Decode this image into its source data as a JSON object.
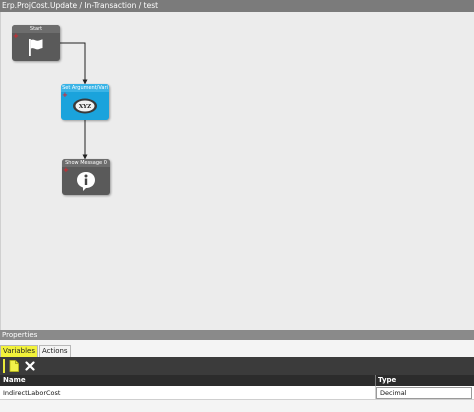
{
  "breadcrumb": "Erp.ProjCost.Update / In-Transaction / test",
  "workflow": {
    "nodes": [
      {
        "id": "start",
        "label": "Start",
        "icon": "flag-icon"
      },
      {
        "id": "set-argument",
        "label": "Set Argument/Vari",
        "icon": "xyz-icon",
        "icon_text": "XYZ"
      },
      {
        "id": "show-message",
        "label": "Show Message 0",
        "icon": "info-icon"
      }
    ],
    "colors": {
      "activity_blue": "#1aa3dc",
      "activity_dark": "#5a5a5a",
      "add_marker_red": "#e0222a"
    }
  },
  "properties": {
    "title": "Properties",
    "tabs": [
      {
        "label": "Variables",
        "active": true
      },
      {
        "label": "Actions",
        "active": false
      }
    ],
    "toolbar": {
      "add_icon": "new-document-icon",
      "delete_icon": "delete-x-icon"
    },
    "columns": [
      "Name",
      "Type"
    ],
    "rows": [
      {
        "name": "IndirectLaborCost",
        "type": "Decimal"
      }
    ]
  }
}
